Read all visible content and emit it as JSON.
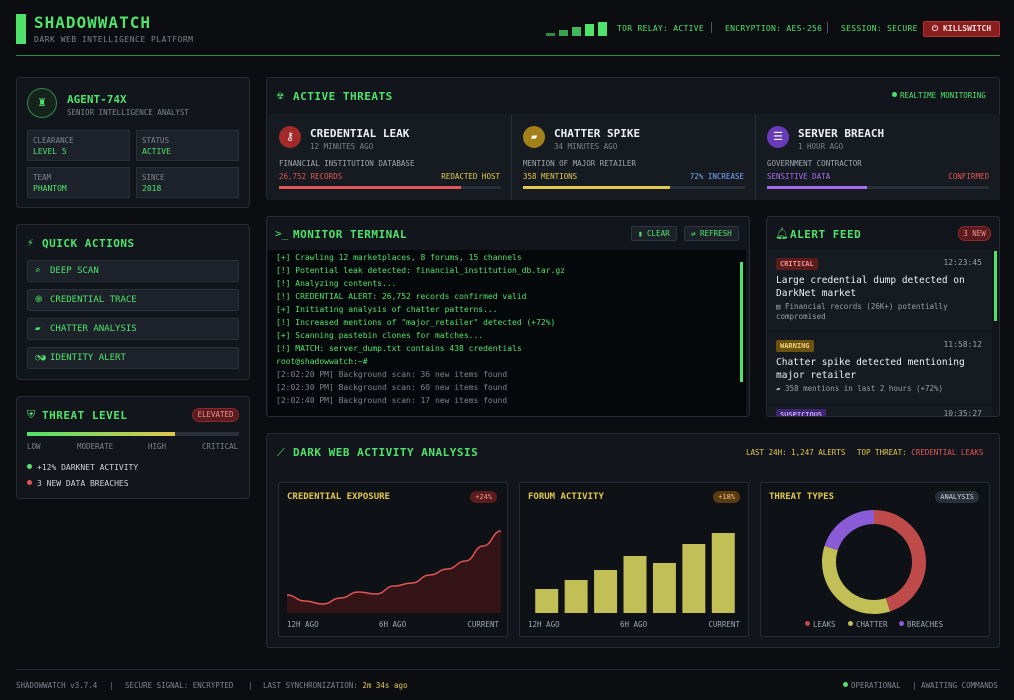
{
  "header": {
    "title": "SHADOWWATCH",
    "subtitle": "DARK WEB INTELLIGENCE PLATFORM",
    "signal_bars": 5,
    "tor_relay": "TOR RELAY: ACTIVE",
    "encryption": "ENCRYPTION: AES-256",
    "session": "SESSION: SECURE",
    "killswitch": "KILLSWITCH",
    "killswitch_icon": "power-icon"
  },
  "agent": {
    "name": "AGENT-74X",
    "role": "SENIOR INTELLIGENCE ANALYST",
    "avatar_icon": "user-secret-icon",
    "fields": [
      {
        "label": "CLEARANCE",
        "value": "LEVEL 5"
      },
      {
        "label": "STATUS",
        "value": "ACTIVE"
      },
      {
        "label": "TEAM",
        "value": "PHANTOM"
      },
      {
        "label": "SINCE",
        "value": "2018"
      }
    ]
  },
  "quick_actions": {
    "title": "QUICK ACTIONS",
    "items": [
      {
        "label": "DEEP SCAN",
        "icon": "search-icon"
      },
      {
        "label": "CREDENTIAL TRACE",
        "icon": "fingerprint-icon"
      },
      {
        "label": "CHATTER ANALYSIS",
        "icon": "comment-icon"
      },
      {
        "label": "IDENTITY ALERT",
        "icon": "mask-icon"
      }
    ]
  },
  "threat_level": {
    "title": "THREAT LEVEL",
    "badge": "ELEVATED",
    "level_fraction": 0.7,
    "scale": [
      "LOW",
      "MODERATE",
      "HIGH",
      "CRITICAL"
    ],
    "bullets": [
      {
        "text": "+12% DARKNET ACTIVITY",
        "color": "#4fe36b"
      },
      {
        "text": "3 NEW DATA BREACHES",
        "color": "#e25656"
      }
    ]
  },
  "active_threats": {
    "title": "ACTIVE THREATS",
    "status": "REALTIME MONITORING",
    "cards": [
      {
        "title": "CREDENTIAL LEAK",
        "ago": "12 MINUTES AGO",
        "desc": "FINANCIAL INSTITUTION DATABASE",
        "left": "26,752 RECORDS",
        "right": "REDACTED HOST",
        "progress": 0.82,
        "color": "#e25656",
        "right_color": "#e2c84a",
        "icon": "key-icon"
      },
      {
        "title": "CHATTER SPIKE",
        "ago": "34 MINUTES AGO",
        "desc": "MENTION OF MAJOR RETAILER",
        "left": "358 MENTIONS",
        "right": "72% INCREASE",
        "progress": 0.66,
        "color": "#e2c84a",
        "right_color": "#7aa7ff",
        "icon": "comments-icon"
      },
      {
        "title": "SERVER BREACH",
        "ago": "1 HOUR AGO",
        "desc": "GOVERNMENT CONTRACTOR",
        "left": "SENSITIVE DATA",
        "right": "CONFIRMED",
        "progress": 0.45,
        "color": "#a86cf0",
        "right_color": "#e25656",
        "icon": "server-icon"
      }
    ]
  },
  "terminal": {
    "title": "MONITOR TERMINAL",
    "clear": "CLEAR",
    "refresh": "REFRESH",
    "lines": [
      {
        "text": "[+] Crawling 12 marketplaces, 8 forums, 15 channels",
        "color": "#4fe36b"
      },
      {
        "text": "[!] Potential leak detected: financial_institution_db.tar.gz",
        "color": "#4fe36b"
      },
      {
        "text": "[!] Analyzing contents...",
        "color": "#4fe36b"
      },
      {
        "text": "[!] CREDENTIAL ALERT: 26,752 records confirmed valid",
        "color": "#4fe36b"
      },
      {
        "text": "[+] Initiating analysis of chatter patterns...",
        "color": "#4fe36b"
      },
      {
        "text": "[!] Increased mentions of \"major_retailer\" detected (+72%)",
        "color": "#4fe36b"
      },
      {
        "text": "[+] Scanning pastebin clones for matches...",
        "color": "#4fe36b"
      },
      {
        "text": "[!] MATCH: server_dump.txt contains 438 credentials",
        "color": "#4fe36b"
      },
      {
        "text": "root@shadowwatch:~#",
        "color": "#4fe36b"
      },
      {
        "text": "[2:02:20 PM] Background scan: 36 new items found",
        "color": "#7d838d"
      },
      {
        "text": "[2:02:30 PM] Background scan: 60 new items found",
        "color": "#7d838d"
      },
      {
        "text": "[2:02:40 PM] Background scan: 17 new items found",
        "color": "#7d838d"
      }
    ]
  },
  "alert_feed": {
    "title": "ALERT FEED",
    "badge": "3 NEW",
    "alerts": [
      {
        "severity": "CRITICAL",
        "sev_bg": "#5a1c1c",
        "sev_color": "#f09090",
        "time": "12:23:45",
        "message": "Large credential dump detected on DarkNet market",
        "detail": "Financial records (26K+) potentially compromised",
        "detail_icon": "database-icon"
      },
      {
        "severity": "WARNING",
        "sev_bg": "#6b5210",
        "sev_color": "#f2d27a",
        "time": "11:58:12",
        "message": "Chatter spike detected mentioning major retailer",
        "detail": "358 mentions in last 2 hours (+72%)",
        "detail_icon": "comment-icon"
      },
      {
        "severity": "SUSPICIOUS",
        "sev_bg": "#3e2670",
        "sev_color": "#c9a8ff",
        "time": "10:35:27",
        "message": "",
        "detail": "",
        "detail_icon": ""
      }
    ]
  },
  "analysis": {
    "title": "DARK WEB ACTIVITY ANALYSIS",
    "last24_label": "LAST 24H:",
    "last24_value": "1,247 ALERTS",
    "top_label": "TOP THREAT:",
    "top_value": "CREDENTIAL LEAKS"
  },
  "chart_data": [
    {
      "type": "area",
      "title": "CREDENTIAL EXPOSURE",
      "badge": "+24%",
      "x_ticks": [
        "12H AGO",
        "6H AGO",
        "CURRENT"
      ],
      "x": [
        0,
        1,
        2,
        3,
        4,
        5,
        6,
        7,
        8,
        9,
        10,
        11,
        12
      ],
      "values": [
        18,
        12,
        9,
        15,
        21,
        19,
        27,
        30,
        38,
        44,
        52,
        67,
        82
      ],
      "ylim": [
        0,
        100
      ],
      "color": "#e25656"
    },
    {
      "type": "bar",
      "title": "FORUM ACTIVITY",
      "badge": "+18%",
      "x_ticks": [
        "12H AGO",
        "6H AGO",
        "CURRENT"
      ],
      "values": [
        24,
        33,
        43,
        57,
        50,
        69,
        80
      ],
      "ylim": [
        0,
        100
      ],
      "color": "#c2bf57"
    },
    {
      "type": "pie",
      "title": "THREAT TYPES",
      "badge": "ANALYSIS",
      "slices": [
        {
          "name": "LEAKS",
          "value": 45,
          "color": "#bf4a4a"
        },
        {
          "name": "CHATTER",
          "value": 35,
          "color": "#c2bf57"
        },
        {
          "name": "BREACHES",
          "value": 20,
          "color": "#8a5cd8"
        }
      ]
    }
  ],
  "footer": {
    "version": "SHADOWWATCH v3.7.4",
    "signal": "SECURE SIGNAL: ENCRYPTED",
    "sync_label": "LAST SYNCHRONIZATION:",
    "sync_value": "2m 34s ago",
    "operational": "OPERATIONAL",
    "awaiting": "AWAITING COMMANDS"
  }
}
